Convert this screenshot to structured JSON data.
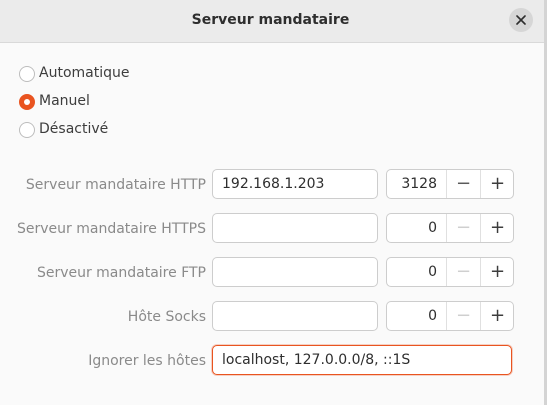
{
  "window": {
    "title": "Serveur mandataire"
  },
  "icons": {
    "close": "close-icon"
  },
  "modes": [
    {
      "label": "Automatique",
      "checked": false
    },
    {
      "label": "Manuel",
      "checked": true
    },
    {
      "label": "Désactivé",
      "checked": false
    }
  ],
  "proxies": [
    {
      "label": "Serveur mandataire HTTP",
      "host": "192.168.1.203",
      "port": "3128",
      "minus_enabled": true
    },
    {
      "label": "Serveur mandataire HTTPS",
      "host": "",
      "port": "0",
      "minus_enabled": false
    },
    {
      "label": "Serveur mandataire FTP",
      "host": "",
      "port": "0",
      "minus_enabled": false
    },
    {
      "label": "Hôte Socks",
      "host": "",
      "port": "0",
      "minus_enabled": false
    }
  ],
  "ignore": {
    "label": "Ignorer les hôtes",
    "value": "localhost, 127.0.0.0/8, ::1S"
  },
  "spin_labels": {
    "minus": "−",
    "plus": "+"
  },
  "colors": {
    "accent": "#e95420",
    "headerbar": "#ebebeb",
    "background": "#fafafa"
  }
}
